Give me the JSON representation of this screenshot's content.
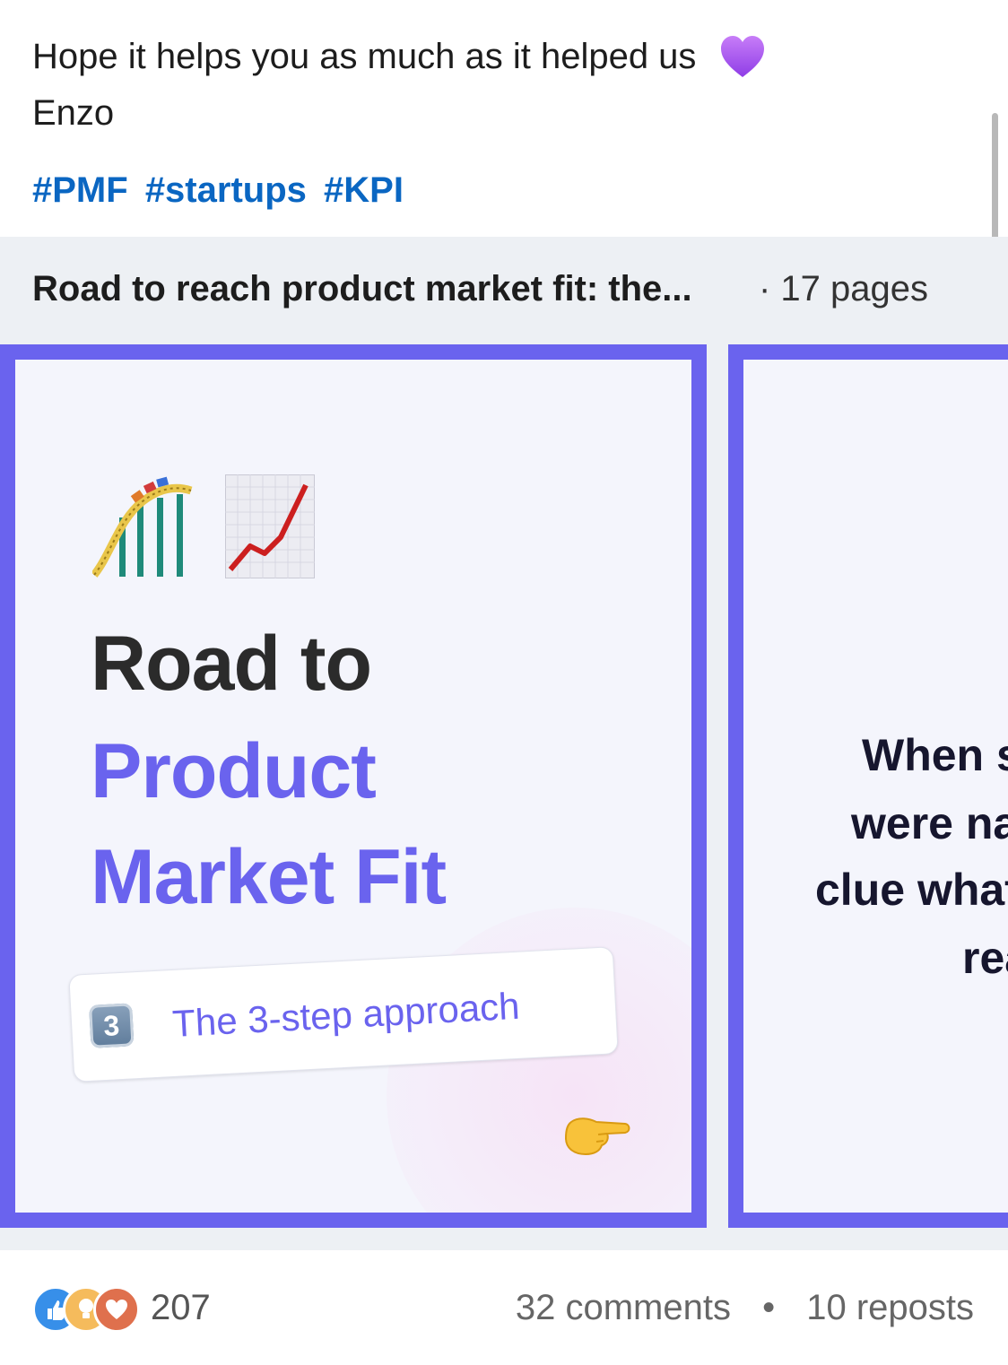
{
  "post": {
    "line1": "Hope it helps you as much as it helped us",
    "line2": "Enzo",
    "hashtags": [
      "#PMF",
      "#startups",
      "#KPI"
    ]
  },
  "document": {
    "title": "Road to reach product market fit: the...",
    "pages": "· 17 pages"
  },
  "slide1": {
    "title_line1": "Road to",
    "title_line2": "Product",
    "title_line3": "Market Fit",
    "keycap": "3",
    "approach": "The 3-step approach"
  },
  "slide2": {
    "line1": "When s",
    "line2": "were na",
    "line3": "clue what",
    "line4": "rea"
  },
  "social": {
    "reactions_count": "207",
    "comments": "32 comments",
    "separator": "•",
    "reposts": "10 reposts"
  },
  "icons": [
    "purple-heart-icon",
    "roller-coaster-icon",
    "chart-increasing-icon",
    "keycap-3-icon",
    "pointing-right-icon",
    "like-reaction-icon",
    "insightful-reaction-icon",
    "love-reaction-icon"
  ],
  "colors": {
    "hashtag": "#0a66c2",
    "accent": "#6a63ee",
    "doc_header_bg": "#edf0f4"
  }
}
